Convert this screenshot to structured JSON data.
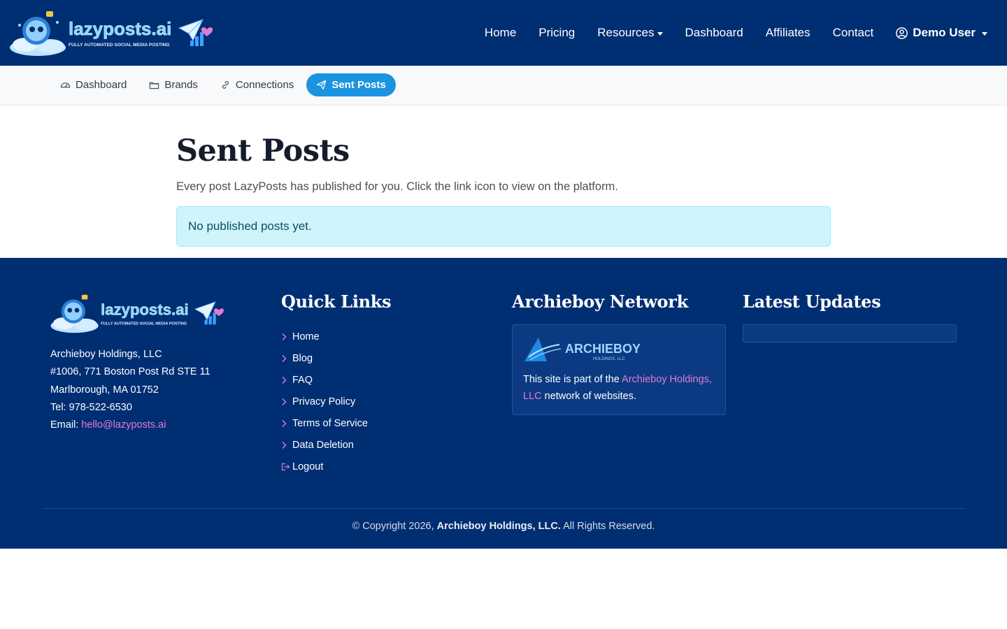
{
  "brand": {
    "name": "lazyposts.ai",
    "tagline": "FULLY AUTOMATED SOCIAL MEDIA POSTING",
    "colors": {
      "navy": "#002e73",
      "accent_blue": "#1a93e0",
      "pink": "#e27ad3",
      "alert_bg": "#cff4fc",
      "alert_text": "#055160"
    }
  },
  "nav": {
    "items": [
      {
        "label": "Home"
      },
      {
        "label": "Pricing"
      },
      {
        "label": "Resources"
      },
      {
        "label": "Dashboard"
      },
      {
        "label": "Affiliates"
      },
      {
        "label": "Contact"
      }
    ],
    "user": {
      "label": "Demo User",
      "icon": "user-circle-icon"
    }
  },
  "subnav": {
    "items": [
      {
        "label": "Dashboard",
        "icon": "speedometer-icon"
      },
      {
        "label": "Brands",
        "icon": "folder-icon"
      },
      {
        "label": "Connections",
        "icon": "link-icon"
      },
      {
        "label": "Sent Posts",
        "icon": "send-icon",
        "active": true
      }
    ]
  },
  "main": {
    "title": "Sent Posts",
    "subtitle": "Every post LazyPosts has published for you. Click the link icon to view on the platform.",
    "alert": "No published posts yet."
  },
  "footer": {
    "address": {
      "company": "Archieboy Holdings, LLC",
      "street": "#1006, 771 Boston Post Rd STE 11",
      "city": "Marlborough, MA 01752",
      "tel_label": "Tel:",
      "tel": "978-522-6530",
      "email_label": "Email:",
      "email": "hello@lazyposts.ai"
    },
    "quick_links": {
      "heading": "Quick Links",
      "items": [
        {
          "label": "Home",
          "icon": "chevron-right-icon"
        },
        {
          "label": "Blog",
          "icon": "chevron-right-icon"
        },
        {
          "label": "FAQ",
          "icon": "chevron-right-icon"
        },
        {
          "label": "Privacy Policy",
          "icon": "chevron-right-icon"
        },
        {
          "label": "Terms of Service",
          "icon": "chevron-right-icon"
        },
        {
          "label": "Data Deletion",
          "icon": "chevron-right-icon"
        },
        {
          "label": "Logout",
          "icon": "logout-icon"
        }
      ]
    },
    "network": {
      "heading": "Archieboy Network",
      "logo_text": "ARCHIEBOY",
      "logo_sub": "HOLDINGS, LLC",
      "text_before": "This site is part of the",
      "link": "Archieboy Holdings, LLC",
      "text_after": "network of websites."
    },
    "updates": {
      "heading": "Latest Updates"
    },
    "copyright": {
      "prefix": "© Copyright 2026,",
      "company": "Archieboy Holdings, LLC.",
      "suffix": "All Rights Reserved."
    }
  }
}
